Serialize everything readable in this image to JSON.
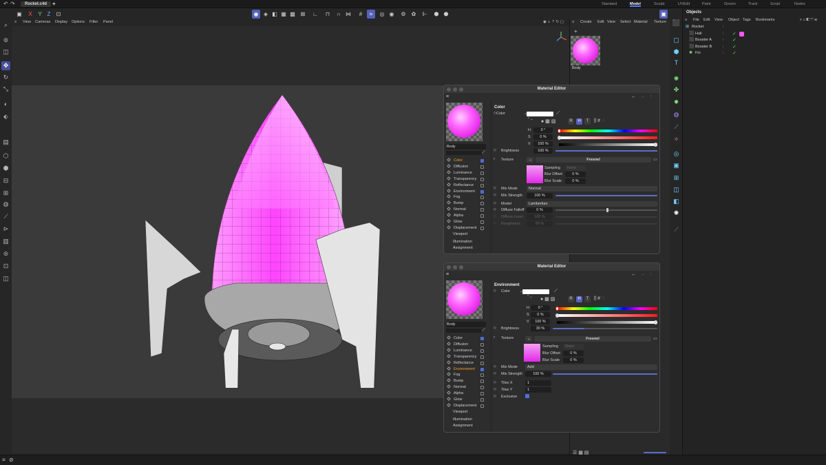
{
  "app": {
    "file_tab": "Rocket.c4d",
    "add_tab": "+",
    "layouts": [
      "Standard",
      "Model",
      "Sculpt",
      "UVEdit",
      "Paint",
      "Groom",
      "Track",
      "Script",
      "Nodes"
    ],
    "active_layout": "Model"
  },
  "toolbar": {
    "axis_x": "X",
    "axis_y": "Y",
    "axis_z": "Z"
  },
  "viewport_menu": [
    "View",
    "Cameras",
    "Display",
    "Options",
    "Filter",
    "Panel"
  ],
  "material_manager": {
    "menu": [
      "Create",
      "Edit",
      "View",
      "Select",
      "Material",
      "Texture"
    ],
    "material_name": "Body"
  },
  "objects": {
    "title": "Objects",
    "menu": [
      "File",
      "Edit",
      "View",
      "Object",
      "Tags",
      "Bookmarks"
    ],
    "items": [
      {
        "name": "Rocket"
      },
      {
        "name": "Hull"
      },
      {
        "name": "Booster A"
      },
      {
        "name": "Booster B"
      },
      {
        "name": "Fin"
      }
    ]
  },
  "editor1": {
    "title": "Material Editor",
    "material": "Body",
    "channels": [
      {
        "label": "Color",
        "checked": true,
        "selected": true,
        "hasbox": true
      },
      {
        "label": "Diffusion",
        "checked": false,
        "hasbox": true
      },
      {
        "label": "Luminance",
        "checked": false,
        "hasbox": true
      },
      {
        "label": "Transparency",
        "checked": false,
        "hasbox": true
      },
      {
        "label": "Reflectance",
        "checked": false,
        "hasbox": true
      },
      {
        "label": "Environment",
        "checked": true,
        "hasbox": true
      },
      {
        "label": "Fog",
        "checked": false,
        "hasbox": true
      },
      {
        "label": "Bump",
        "checked": false,
        "hasbox": true
      },
      {
        "label": "Normal",
        "checked": false,
        "hasbox": true
      },
      {
        "label": "Alpha",
        "checked": false,
        "hasbox": true
      },
      {
        "label": "Glow",
        "checked": false,
        "hasbox": true
      },
      {
        "label": "Displacement",
        "checked": false,
        "hasbox": true
      },
      {
        "label": "Viewport",
        "hasbox": false
      },
      {
        "label": "Illumination",
        "hasbox": false
      },
      {
        "label": "Assignment",
        "hasbox": false
      }
    ],
    "section": "Color",
    "color_label": "Color",
    "mode_buttons": [
      "R",
      "H",
      "T"
    ],
    "h_label": "H",
    "h_value": "0 °",
    "s_label": "S",
    "s_value": "0 %",
    "v_label": "V",
    "v_value": "100 %",
    "brightness_label": "Brightness",
    "brightness_value": "100 %",
    "texture_label": "Texture",
    "texture_name": "Fresnel",
    "sampling_label": "Sampling",
    "sampling_value": "None",
    "blur_offset_label": "Blur Offset",
    "blur_offset_value": "0 %",
    "blur_scale_label": "Blur Scale",
    "blur_scale_value": "0 %",
    "mix_mode_label": "Mix Mode",
    "mix_mode_value": "Normal",
    "mix_strength_label": "Mix Strength",
    "mix_strength_value": "100 %",
    "model_label": "Model",
    "model_value": "Lambertian",
    "diffuse_falloff_label": "Diffuse Falloff",
    "diffuse_falloff_value": "0 %",
    "diffuse_level_label": "Diffuse Level",
    "diffuse_level_value": "100 %",
    "roughness_label": "Roughness",
    "roughness_value": "50 %",
    "brightness_fraction": 1.0,
    "falloff_fraction": 0.5
  },
  "editor2": {
    "title": "Material Editor",
    "material": "Body",
    "channels": [
      {
        "label": "Color",
        "checked": true,
        "hasbox": true
      },
      {
        "label": "Diffusion",
        "checked": false,
        "hasbox": true
      },
      {
        "label": "Luminance",
        "checked": false,
        "hasbox": true
      },
      {
        "label": "Transparency",
        "checked": false,
        "hasbox": true
      },
      {
        "label": "Reflectance",
        "checked": false,
        "hasbox": true
      },
      {
        "label": "Environment",
        "checked": true,
        "selected": true,
        "hasbox": true
      },
      {
        "label": "Fog",
        "checked": false,
        "hasbox": true
      },
      {
        "label": "Bump",
        "checked": false,
        "hasbox": true
      },
      {
        "label": "Normal",
        "checked": false,
        "hasbox": true
      },
      {
        "label": "Alpha",
        "checked": false,
        "hasbox": true
      },
      {
        "label": "Glow",
        "checked": false,
        "hasbox": true
      },
      {
        "label": "Displacement",
        "checked": false,
        "hasbox": true
      },
      {
        "label": "Viewport",
        "hasbox": false
      },
      {
        "label": "Illumination",
        "hasbox": false
      },
      {
        "label": "Assignment",
        "hasbox": false
      }
    ],
    "section": "Environment",
    "color_label": "Color",
    "mode_buttons": [
      "R",
      "H",
      "T"
    ],
    "h_label": "H",
    "h_value": "0 °",
    "s_label": "S",
    "s_value": "0 %",
    "v_label": "V",
    "v_value": "100 %",
    "brightness_label": "Brightness",
    "brightness_value": "30 %",
    "texture_label": "Texture",
    "texture_name": "Fresnel",
    "sampling_label": "Sampling",
    "sampling_value": "None",
    "blur_offset_label": "Blur Offset",
    "blur_offset_value": "0 %",
    "blur_scale_label": "Blur Scale",
    "blur_scale_value": "0 %",
    "mix_mode_label": "Mix Mode",
    "mix_mode_value": "Add",
    "mix_strength_label": "Mix Strength",
    "mix_strength_value": "100 %",
    "tiles_x_label": "Tiles X",
    "tiles_x_value": "1",
    "tiles_y_label": "Tiles Y",
    "tiles_y_value": "1",
    "exclusive_label": "Exclusive",
    "brightness_fraction": 0.3
  },
  "colors": {
    "accent": "#5560b8",
    "selected_channel": "#ff9a2a",
    "material_pink": "#ff55ff"
  }
}
